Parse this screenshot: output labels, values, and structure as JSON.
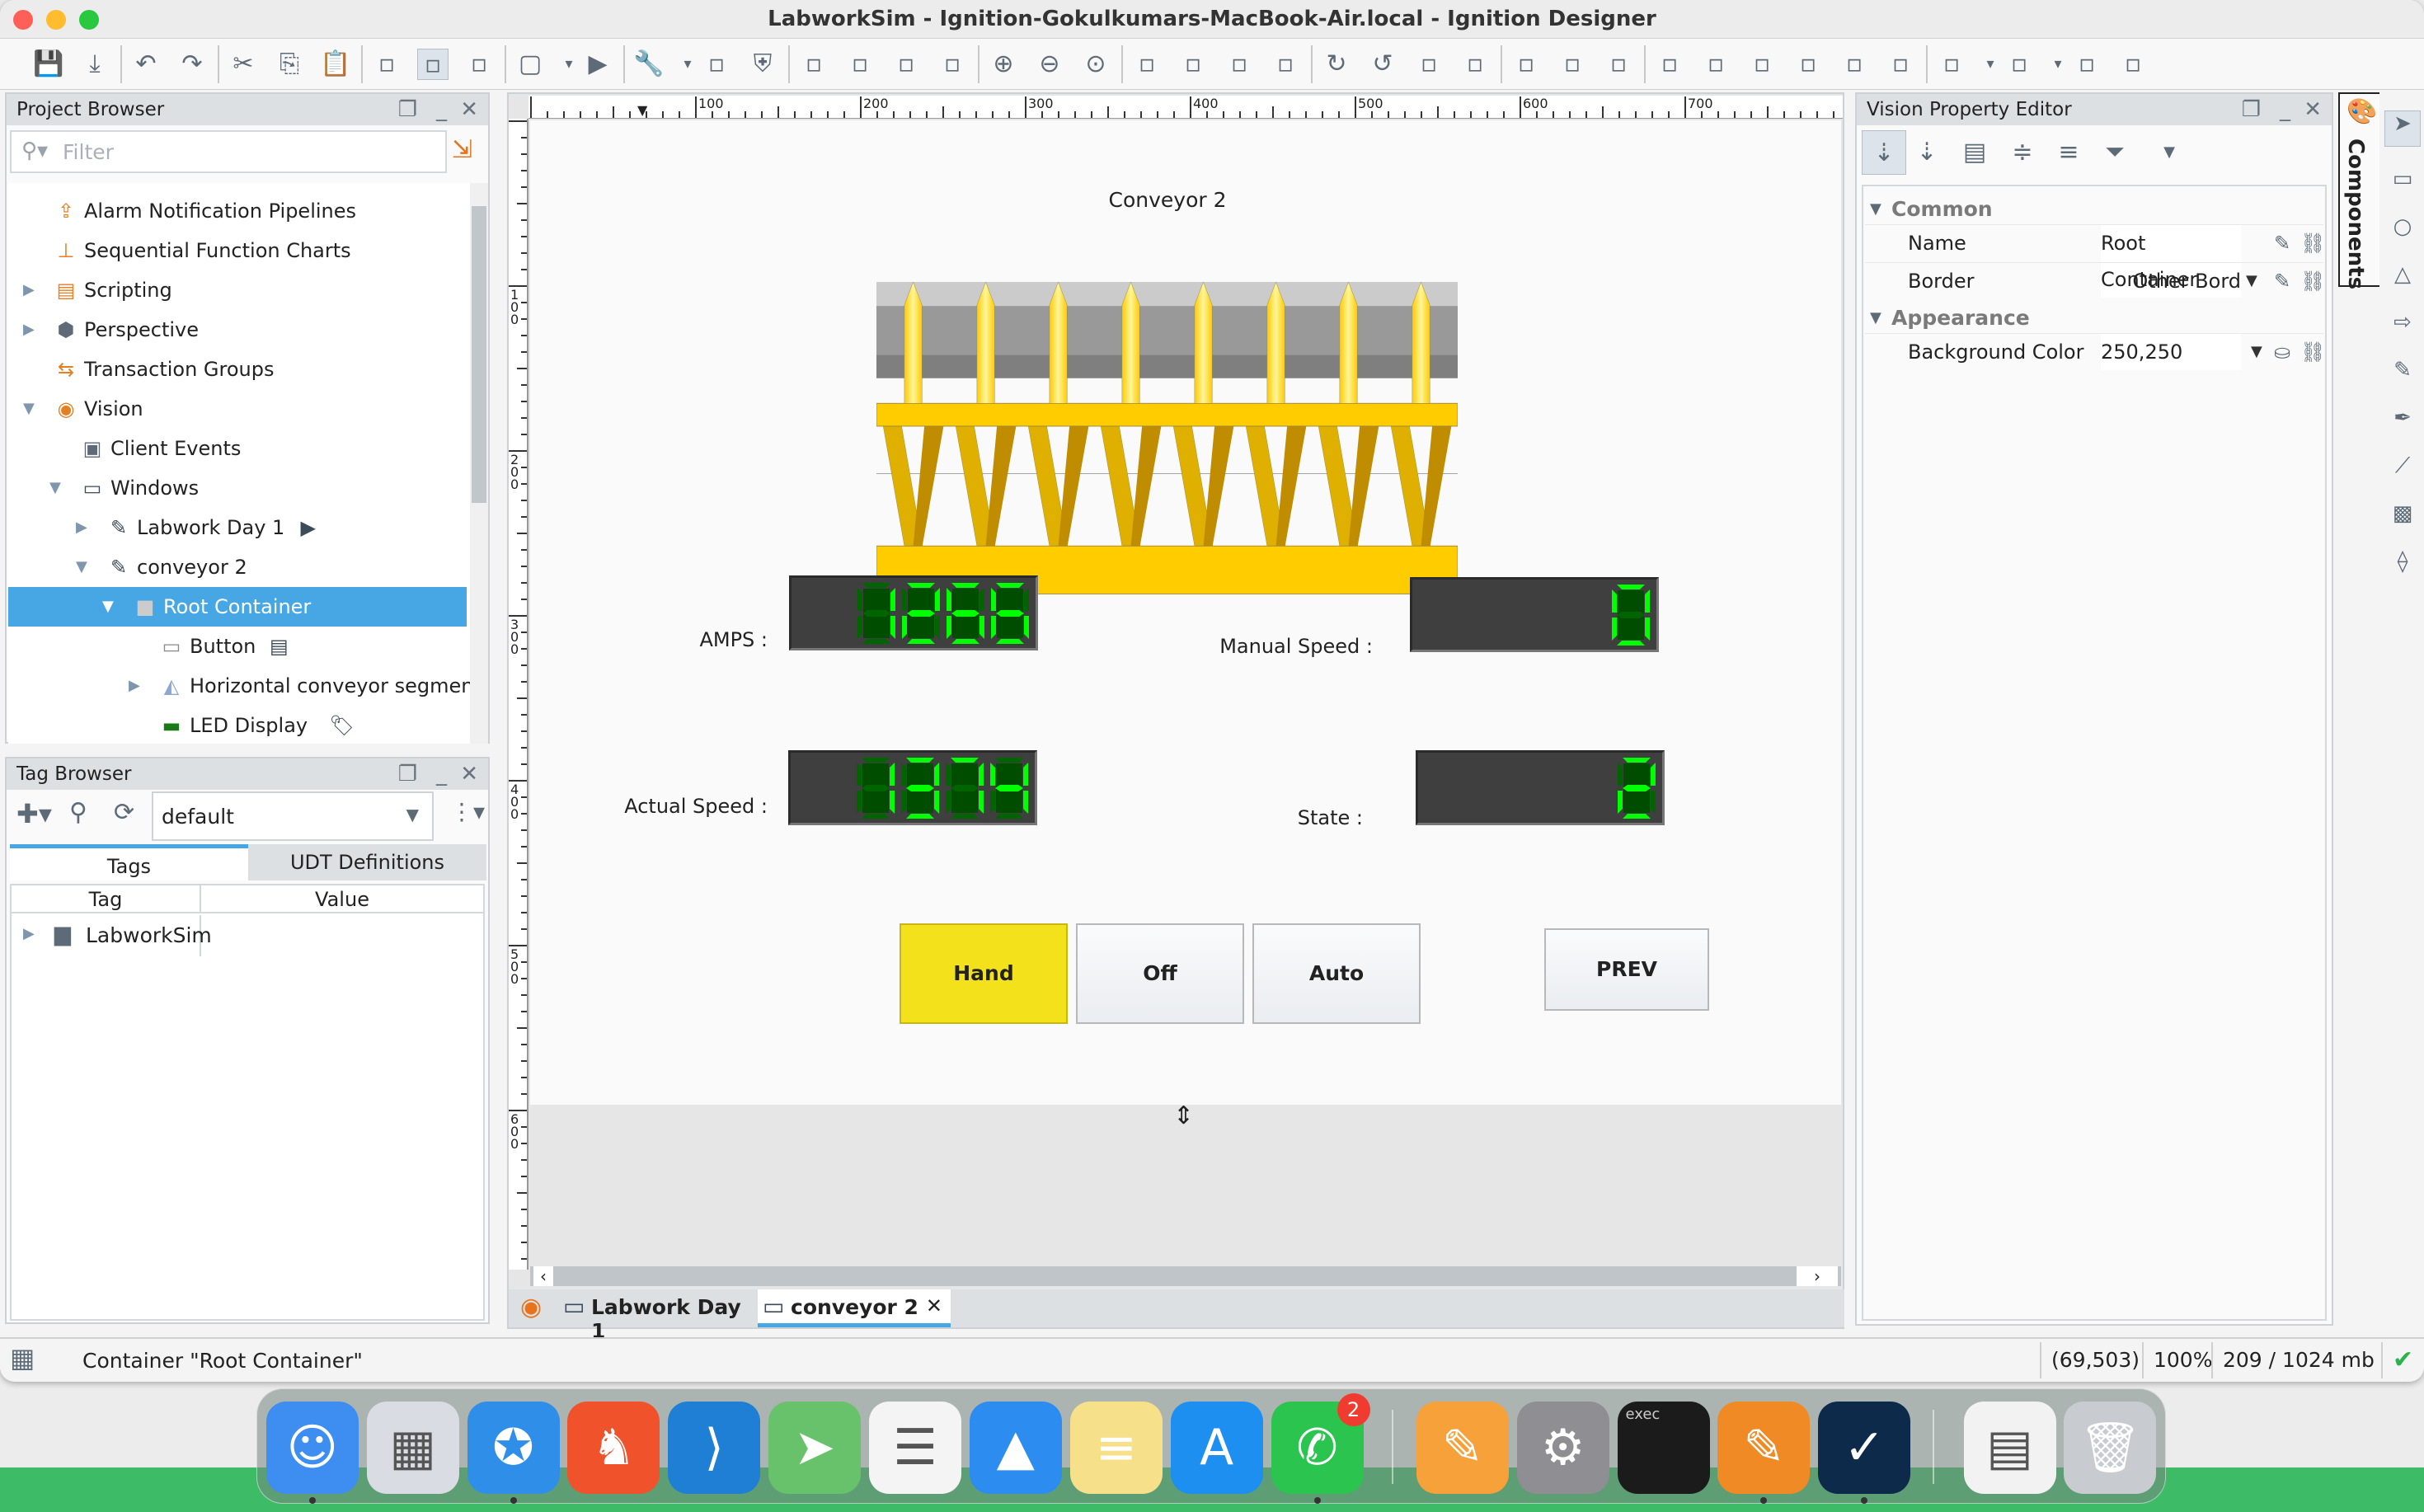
{
  "window": {
    "title": "LabworkSim - Ignition-Gokulkumars-MacBook-Air.local - Ignition Designer"
  },
  "toolbar": {
    "icons": [
      "save-icon",
      "save-all-icon",
      "undo-icon",
      "redo-icon",
      "cut-icon",
      "copy-icon",
      "paste-icon",
      "snap-off-icon",
      "snap-icon",
      "layout-icon",
      "window-icon",
      "dropdown-icon",
      "play-icon",
      "wrench-icon",
      "dropdown-icon",
      "script-icon",
      "shield-icon",
      "resize-icon",
      "resize-both-icon",
      "group-icon",
      "align-icon",
      "zoom-in-icon",
      "zoom-out-icon",
      "zoom-actual-icon",
      "bring-front-icon",
      "send-back-icon",
      "move-forward-icon",
      "move-backward-icon",
      "rotate-icon",
      "rotate-left-icon",
      "flip-h-icon",
      "flip-v-icon",
      "union-icon",
      "subtract-icon",
      "intersect-icon",
      "align-left-icon",
      "align-center-icon",
      "align-right-icon",
      "align-top-icon",
      "align-middle-icon",
      "align-bottom-icon",
      "distribute-h-icon",
      "dropdown-icon",
      "distribute-v-icon",
      "dropdown-icon",
      "same-width-icon",
      "same-height-icon"
    ],
    "selected_index": 8
  },
  "project_browser": {
    "title": "Project Browser",
    "filter_placeholder": "Filter",
    "items": [
      {
        "label": "Alarm Notification Pipelines",
        "depth": 0,
        "expander": "none",
        "icon": "alarm-pipeline-icon",
        "glyph": "⇪",
        "color": "#e67e22"
      },
      {
        "label": "Sequential Function Charts",
        "depth": 0,
        "expander": "none",
        "icon": "sfc-icon",
        "glyph": "⊥",
        "color": "#e67e22"
      },
      {
        "label": "Scripting",
        "depth": 0,
        "expander": "collapsed",
        "icon": "scripting-icon",
        "glyph": "▤",
        "color": "#e67e22"
      },
      {
        "label": "Perspective",
        "depth": 0,
        "expander": "collapsed",
        "icon": "perspective-icon",
        "glyph": "⬢",
        "color": "#5d6b78"
      },
      {
        "label": "Transaction Groups",
        "depth": 0,
        "expander": "none",
        "icon": "transaction-groups-icon",
        "glyph": "⇆",
        "color": "#e67e22"
      },
      {
        "label": "Vision",
        "depth": 0,
        "expander": "expanded",
        "icon": "vision-icon",
        "glyph": "◉",
        "color": "#e67e22"
      },
      {
        "label": "Client Events",
        "depth": 1,
        "expander": "none",
        "icon": "client-events-icon",
        "glyph": "▣",
        "color": "#5d6b78"
      },
      {
        "label": "Windows",
        "depth": 1,
        "expander": "expanded",
        "icon": "windows-folder-icon",
        "glyph": "▭",
        "color": "#3b4b5a"
      },
      {
        "label": "Labwork Day 1",
        "depth": 2,
        "expander": "collapsed",
        "icon": "window-edit-icon",
        "glyph": "✎",
        "color": "#3b4b5a",
        "badge_icon": "open-window-icon"
      },
      {
        "label": "conveyor 2",
        "depth": 2,
        "expander": "expanded",
        "icon": "window-edit-icon",
        "glyph": "✎",
        "color": "#3b4b5a"
      },
      {
        "label": "Root Container",
        "depth": 3,
        "expander": "expanded",
        "icon": "container-icon",
        "glyph": "■",
        "color": "#cccccc",
        "selected": true
      },
      {
        "label": "Button",
        "depth": 4,
        "expander": "none",
        "icon": "button-component-icon",
        "glyph": "▭",
        "color": "#888888",
        "badge_icon": "script-icon"
      },
      {
        "label": "Horizontal conveyor segment",
        "depth": 4,
        "expander": "collapsed",
        "icon": "conveyor-symbol-icon",
        "glyph": "◭",
        "color": "#8fa8d0"
      },
      {
        "label": "LED Display",
        "depth": 4,
        "expander": "none",
        "icon": "led-display-icon",
        "glyph": "▬",
        "color": "#1a7a1a",
        "badge_icon": "tag-icon"
      }
    ]
  },
  "tag_browser": {
    "title": "Tag Browser",
    "provider": "default",
    "tabs": [
      {
        "label": "Tags",
        "active": true
      },
      {
        "label": "UDT Definitions",
        "active": false
      }
    ],
    "columns": [
      "Tag",
      "Value"
    ],
    "rows": [
      {
        "tag": "LabworkSim",
        "value": ""
      }
    ]
  },
  "rulers": {
    "horizontal": [
      "100",
      "200",
      "300",
      "400",
      "500",
      "600",
      "700"
    ],
    "vertical": [
      "100",
      "200",
      "300",
      "400",
      "500",
      "600"
    ]
  },
  "canvas": {
    "title": "Conveyor 2",
    "labels": {
      "amps": "AMPS :",
      "manual_speed": "Manual Speed :",
      "actual_speed": "Actual Speed :",
      "state": "State :"
    },
    "leds": {
      "amps": "1266",
      "manual_speed": "0",
      "actual_speed": "1374",
      "state": "2"
    },
    "led_colors": {
      "lit": "#00ff00",
      "dim": "#006400",
      "background": "#3f3f3f"
    },
    "buttons": {
      "hand": "Hand",
      "off": "Off",
      "auto": "Auto",
      "prev": "PREV"
    },
    "hand_color": "#f3e21b",
    "conveyor_color": "#ffcc00"
  },
  "doc_tabs": [
    {
      "label": "Labwork Day 1",
      "active": false
    },
    {
      "label": "conveyor 2",
      "active": true,
      "closable": true
    }
  ],
  "property_editor": {
    "title": "Vision Property Editor",
    "sections": [
      {
        "name": "Common",
        "props": [
          {
            "name": "Name",
            "value": "Root Container"
          },
          {
            "name": "Border",
            "value": "Other Bord"
          }
        ]
      },
      {
        "name": "Appearance",
        "props": [
          {
            "name": "Background Color",
            "value": "250,250"
          }
        ]
      }
    ]
  },
  "side_tab": {
    "label": "Components"
  },
  "status_bar": {
    "message": "Container \"Root Container\"",
    "coords": "(69,503)",
    "zoom": "100%",
    "memory": "209 / 1024 mb"
  },
  "dock": {
    "apps": [
      {
        "name": "finder-icon",
        "color": "#3d8ef0",
        "glyph": "☺"
      },
      {
        "name": "launchpad-icon",
        "color": "#d9dde3",
        "glyph": "▦"
      },
      {
        "name": "safari-icon",
        "color": "#2f8fe8",
        "glyph": "✪"
      },
      {
        "name": "brave-icon",
        "color": "#f0532b",
        "glyph": "♞"
      },
      {
        "name": "vscode-icon",
        "color": "#1f7fd4",
        "glyph": "⟩"
      },
      {
        "name": "maps-icon",
        "color": "#68c26b",
        "glyph": "➤"
      },
      {
        "name": "reminders-icon",
        "color": "#f4f4f4",
        "glyph": "☰"
      },
      {
        "name": "keynote-icon",
        "color": "#2c8cf0",
        "glyph": "▲"
      },
      {
        "name": "notes-icon",
        "color": "#f7e08a",
        "glyph": "≡"
      },
      {
        "name": "app-store-icon",
        "color": "#1d8ff0",
        "glyph": "A"
      },
      {
        "name": "whatsapp-icon",
        "color": "#2bc44f",
        "glyph": "✆",
        "badge": "2"
      },
      {
        "name": "ignition-launcher-icon",
        "color": "#f7a13b",
        "glyph": "✎"
      },
      {
        "name": "system-settings-icon",
        "color": "#8e8e93",
        "glyph": "⚙"
      },
      {
        "name": "terminal-icon",
        "color": "#1b1b1b",
        "glyph": "",
        "caption": "exec"
      },
      {
        "name": "ignition-designer-icon",
        "color": "#f08a24",
        "glyph": "✎"
      },
      {
        "name": "ignition-vision-icon",
        "color": "#0e2a4a",
        "glyph": "✓"
      },
      {
        "name": "file-icon",
        "color": "#f2f2f2",
        "glyph": "▤"
      },
      {
        "name": "trash-icon",
        "color": "#c8cbd0",
        "glyph": "🗑"
      }
    ]
  }
}
